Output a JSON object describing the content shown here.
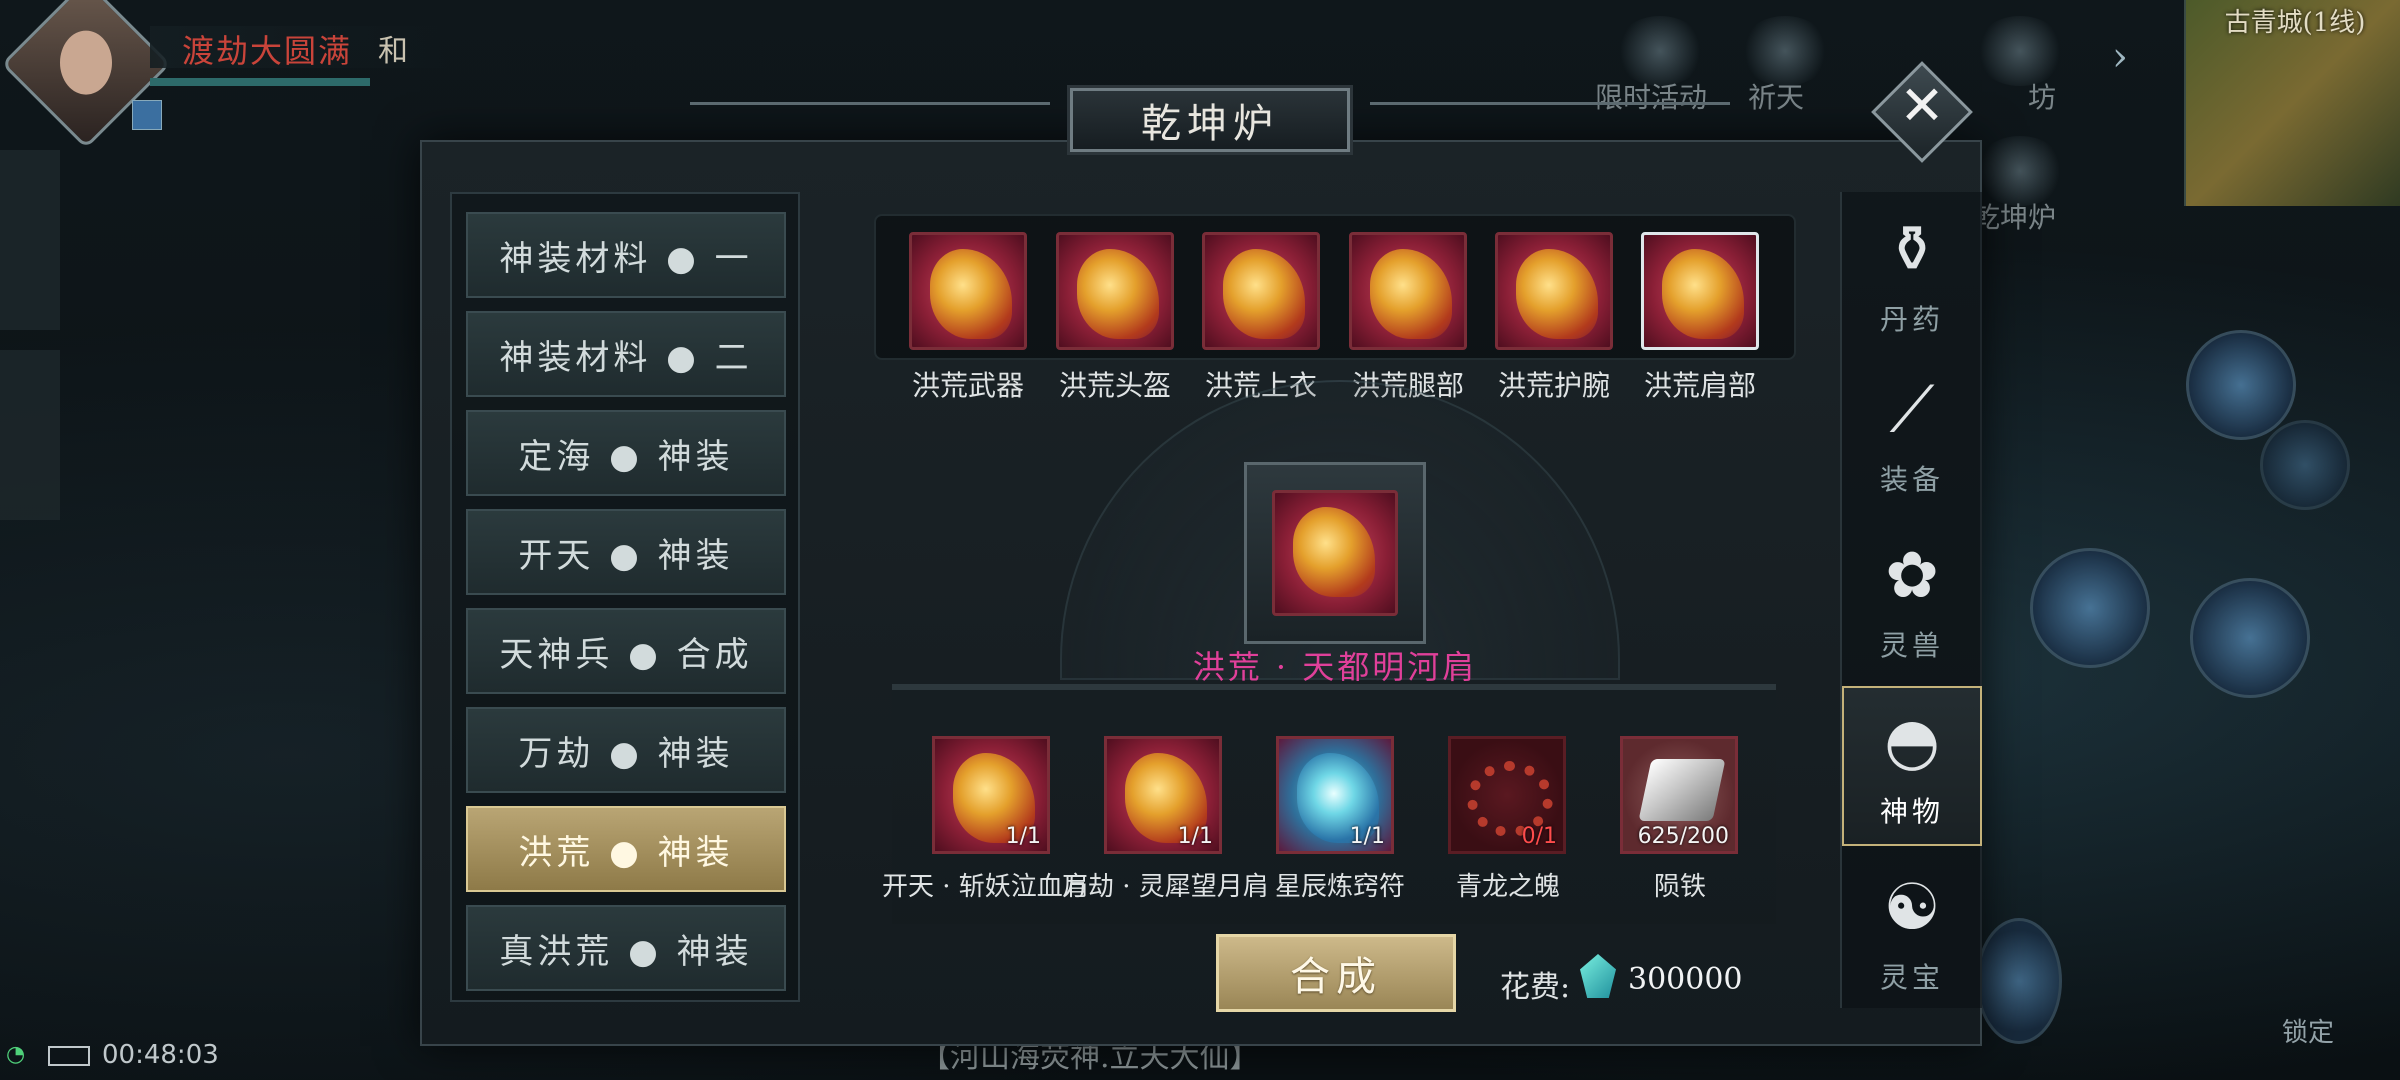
{
  "hud": {
    "player_name": "渡劫大圆满",
    "player_tag": "和",
    "minimap_title": "古青城(1线)",
    "top_labels": [
      "限时活动",
      "祈天",
      "坊",
      "乾坤炉"
    ],
    "clock": "00:48:03",
    "lock_label": "锁定",
    "banner_text": "【河山海荧神.立天大仙】"
  },
  "dialog": {
    "title": "乾坤炉",
    "close_icon": "close-icon"
  },
  "menu": {
    "items": [
      {
        "label": "神装材料 ● 一"
      },
      {
        "label": "神装材料 ● 二"
      },
      {
        "label": "定海 ● 神装"
      },
      {
        "label": "开天 ● 神装"
      },
      {
        "label": "天神兵 ● 合成"
      },
      {
        "label": "万劫 ● 神装"
      },
      {
        "label": "洪荒 ● 神装"
      },
      {
        "label": "真洪荒 ● 神装"
      }
    ],
    "active_index": 6
  },
  "tabs": [
    {
      "label": "丹药",
      "icon": "mortar-icon"
    },
    {
      "label": "装备",
      "icon": "spear-icon"
    },
    {
      "label": "灵兽",
      "icon": "paw-icon"
    },
    {
      "label": "神物",
      "icon": "fan-icon",
      "active": true
    },
    {
      "label": "灵宝",
      "icon": "treasure-icon"
    }
  ],
  "equipment": [
    {
      "label": "洪荒武器",
      "icon": "weapon-icon"
    },
    {
      "label": "洪荒头盔",
      "icon": "helmet-icon"
    },
    {
      "label": "洪荒上衣",
      "icon": "armor-icon"
    },
    {
      "label": "洪荒腿部",
      "icon": "legs-icon"
    },
    {
      "label": "洪荒护腕",
      "icon": "bracer-icon"
    },
    {
      "label": "洪荒肩部",
      "icon": "shoulder-icon",
      "selected": true
    }
  ],
  "target": {
    "name": "洪荒 · 天都明河肩",
    "icon": "shoulder-icon"
  },
  "materials": [
    {
      "label": "开天 · 斩妖泣血肩",
      "count": "1/1",
      "icon": "shoulder-icon",
      "enough": true
    },
    {
      "label": "万劫 · 灵犀望月肩",
      "count": "1/1",
      "icon": "shoulder-icon",
      "enough": true
    },
    {
      "label": "星辰炼窍符",
      "count": "1/1",
      "icon": "crystal-icon",
      "enough": true
    },
    {
      "label": "青龙之魄",
      "count": "0/1",
      "icon": "beads-icon",
      "enough": false
    },
    {
      "label": "陨铁",
      "count": "625/200",
      "icon": "iron-icon",
      "enough": true
    }
  ],
  "compose": {
    "button_label": "合成",
    "cost_label": "花费:",
    "cost_value": "300000",
    "cost_icon": "gem-icon"
  },
  "colors": {
    "accent_gold": "#b9a574",
    "target_name_pink": "#e0409a",
    "lack_red": "#ff4c4c"
  }
}
